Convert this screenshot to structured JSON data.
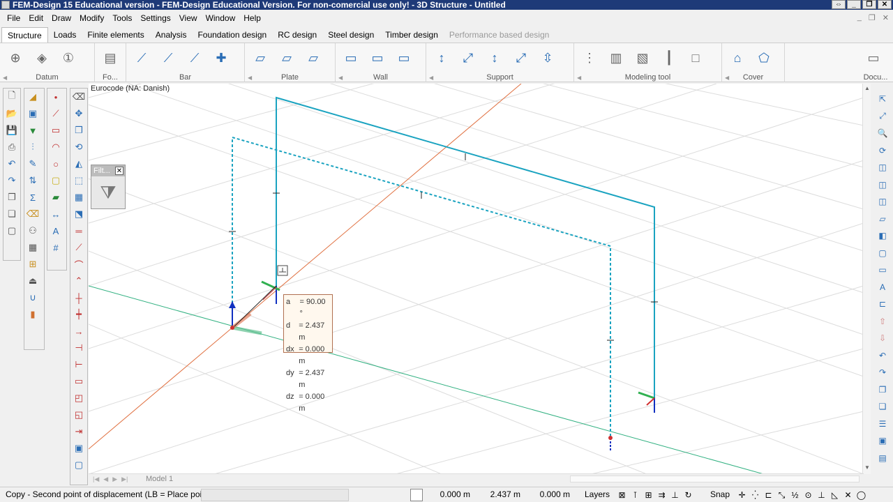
{
  "window": {
    "title": "FEM-Design 15 Educational version - FEM-Design Educational Version. For non-comercial use only! - 3D Structure - Untitled"
  },
  "menu": [
    "File",
    "Edit",
    "Draw",
    "Modify",
    "Tools",
    "Settings",
    "View",
    "Window",
    "Help"
  ],
  "tabs": [
    {
      "label": "Structure",
      "active": true
    },
    {
      "label": "Loads"
    },
    {
      "label": "Finite elements"
    },
    {
      "label": "Analysis"
    },
    {
      "label": "Foundation design"
    },
    {
      "label": "RC design"
    },
    {
      "label": "Steel design"
    },
    {
      "label": "Timber design"
    },
    {
      "label": "Performance based design",
      "disabled": true
    }
  ],
  "ribbon": {
    "groups": [
      "Datum",
      "Fo...",
      "Bar",
      "Plate",
      "Wall",
      "Support",
      "Modeling tool",
      "Cover",
      "Docu..."
    ]
  },
  "viewport": {
    "code_label": "Eurocode (NA: Danish)",
    "model_tab": "Model 1"
  },
  "filter_popup": {
    "title": "Filt..."
  },
  "tooltip": {
    "rows": [
      {
        "key": "a",
        "value": "= 90.00 °"
      },
      {
        "key": "d",
        "value": "= 2.437 m"
      },
      {
        "key": "dx",
        "value": "= 0.000 m"
      },
      {
        "key": "dy",
        "value": "= 2.437 m"
      },
      {
        "key": "dz",
        "value": "= 0.000 m"
      }
    ]
  },
  "status": {
    "prompt": "Copy - Second point of displacement (LB = Place point) :",
    "x": "0.000 m",
    "y": "2.437 m",
    "z": "0.000 m",
    "layers": "Layers",
    "snap": "Snap"
  },
  "colors": {
    "title_bar": "#1e3a78",
    "structure": "#1aa3c0",
    "x_axis": "#e07040",
    "y_axis": "#30b080",
    "grid": "#d8d8d8"
  }
}
